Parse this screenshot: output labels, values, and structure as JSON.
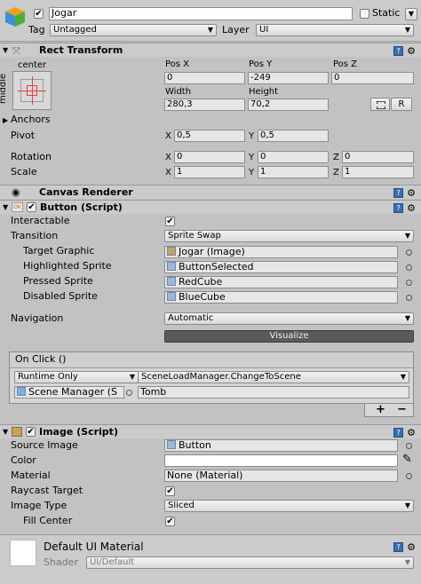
{
  "gameobject": {
    "active": true,
    "name": "Jogar",
    "static_label": "Static",
    "tag_label": "Tag",
    "tag_value": "Untagged",
    "layer_label": "Layer",
    "layer_value": "UI"
  },
  "rect_transform": {
    "title": "Rect Transform",
    "anchor_h": "center",
    "anchor_v": "middle",
    "pos_x_label": "Pos X",
    "pos_y_label": "Pos Y",
    "pos_z_label": "Pos Z",
    "pos_x": "0",
    "pos_y": "-249",
    "pos_z": "0",
    "width_label": "Width",
    "height_label": "Height",
    "width": "280,3",
    "height": "70,2",
    "r_button": "R",
    "anchors_label": "Anchors",
    "pivot_label": "Pivot",
    "pivot_x": "0,5",
    "pivot_y": "0,5",
    "rotation_label": "Rotation",
    "rot_x": "0",
    "rot_y": "0",
    "rot_z": "0",
    "scale_label": "Scale",
    "scale_x": "1",
    "scale_y": "1",
    "scale_z": "1",
    "x": "X",
    "y": "Y",
    "z": "Z"
  },
  "canvas_renderer": {
    "title": "Canvas Renderer"
  },
  "button_script": {
    "title": "Button (Script)",
    "enabled": true,
    "interactable_label": "Interactable",
    "interactable": true,
    "transition_label": "Transition",
    "transition_value": "Sprite Swap",
    "target_graphic_label": "Target Graphic",
    "target_graphic": "Jogar (Image)",
    "highlighted_label": "Highlighted Sprite",
    "highlighted": "ButtonSelected",
    "pressed_label": "Pressed Sprite",
    "pressed": "RedCube",
    "disabled_label": "Disabled Sprite",
    "disabled": "BlueCube",
    "navigation_label": "Navigation",
    "navigation_value": "Automatic",
    "visualize_label": "Visualize",
    "onclick_label": "On Click ()",
    "runtime_value": "Runtime Only",
    "function_value": "SceneLoadManager.ChangeToScene",
    "object_value": "Scene Manager (S",
    "argument_value": "Tomb",
    "plus": "+",
    "minus": "−"
  },
  "image_script": {
    "title": "Image (Script)",
    "enabled": true,
    "source_image_label": "Source Image",
    "source_image": "Button",
    "color_label": "Color",
    "material_label": "Material",
    "material_value": "None (Material)",
    "raycast_label": "Raycast Target",
    "raycast": true,
    "image_type_label": "Image Type",
    "image_type_value": "Sliced",
    "fill_center_label": "Fill Center",
    "fill_center": true
  },
  "material": {
    "name": "Default UI Material",
    "shader_label": "Shader",
    "shader_value": "UI/Default"
  },
  "icons": {
    "check": "✔",
    "gear": "⚙",
    "fold_open": "▼",
    "fold_closed": "▶",
    "arrow": "▼",
    "circle": "◦",
    "eyedropper": "✎"
  }
}
